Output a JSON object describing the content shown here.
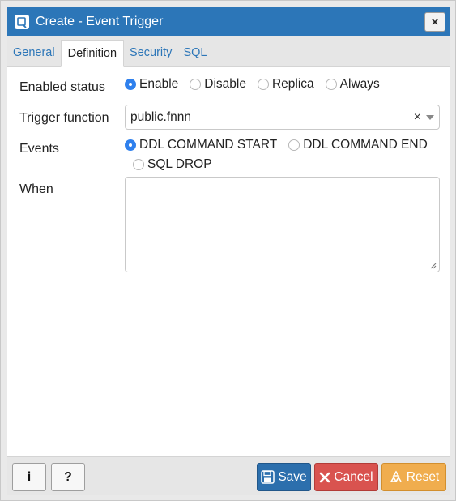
{
  "dialog": {
    "title": "Create - Event Trigger",
    "close_label": "×"
  },
  "tabs": [
    {
      "label": "General",
      "active": false
    },
    {
      "label": "Definition",
      "active": true
    },
    {
      "label": "Security",
      "active": false
    },
    {
      "label": "SQL",
      "active": false
    }
  ],
  "form": {
    "enabled_status": {
      "label": "Enabled status",
      "options": [
        "Enable",
        "Disable",
        "Replica",
        "Always"
      ],
      "selected": "Enable"
    },
    "trigger_function": {
      "label": "Trigger function",
      "value": "public.fnnn",
      "clear_label": "×"
    },
    "events": {
      "label": "Events",
      "options": [
        "DDL COMMAND START",
        "DDL COMMAND END",
        "SQL DROP"
      ],
      "selected": "DDL COMMAND START"
    },
    "when": {
      "label": "When",
      "value": ""
    }
  },
  "footer": {
    "info_label": "i",
    "help_label": "?",
    "save_label": "Save",
    "cancel_label": "Cancel",
    "reset_label": "Reset"
  },
  "colors": {
    "titlebar": "#2c76b8",
    "radio_checked": "#2f80ed",
    "save": "#2c6fad",
    "cancel": "#d9534f",
    "reset": "#f0ad4e"
  },
  "icons": {
    "title": "dialog-window-icon",
    "save": "floppy-disk-icon",
    "cancel": "close-icon",
    "reset": "recycle-icon"
  }
}
